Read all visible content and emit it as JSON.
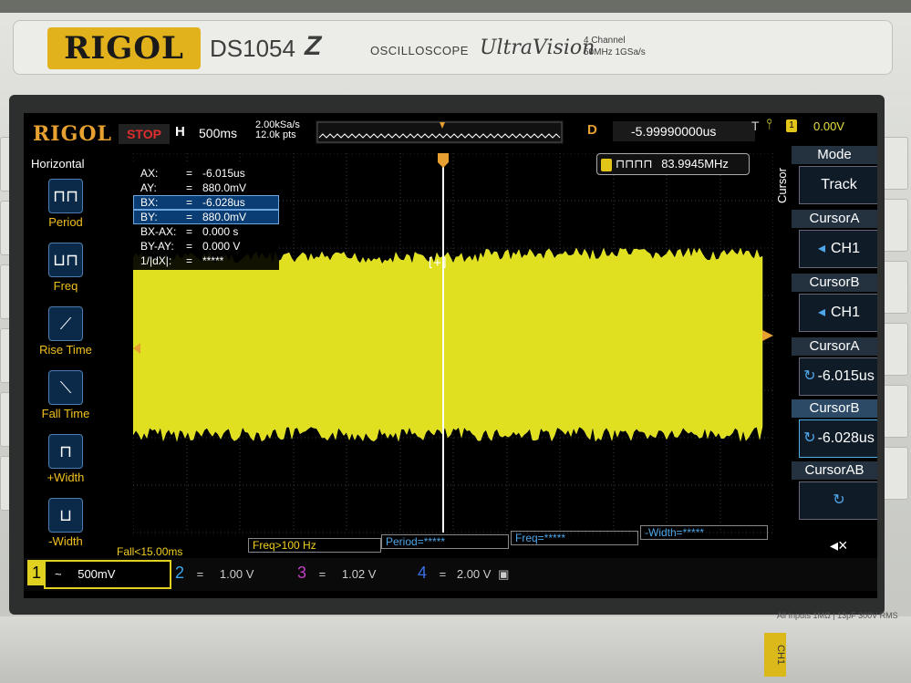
{
  "device": {
    "brand": "RIGOL",
    "model": "DS1054",
    "model_suffix": "Z",
    "type": "OSCILLOSCOPE",
    "series": "UltraVision",
    "spec_line1": "4 Channel",
    "spec_line2": "50MHz 1GSa/s",
    "inputs_label": "All Inputs 1MΩ | 13pF 300V RMS",
    "ch1_connector": "CH1"
  },
  "status": {
    "logo": "RIGOL",
    "run_state": "STOP",
    "timebase_prefix": "H",
    "timebase": "500ms",
    "sample_rate": "2.00kSa/s",
    "mem_points": "12.0k pts",
    "delay_prefix": "D",
    "delay": "-5.99990000us",
    "trigger_type": "T",
    "trigger_badge": "1",
    "trigger_level": "0.00V"
  },
  "left_menu": {
    "title": "Horizontal",
    "items": [
      {
        "label": "Period",
        "icon": "period-icon",
        "glyph": "⊓⊓"
      },
      {
        "label": "Freq",
        "icon": "freq-icon",
        "glyph": "⊔⊓"
      },
      {
        "label": "Rise Time",
        "icon": "rise-time-icon",
        "glyph": "⟋"
      },
      {
        "label": "Fall Time",
        "icon": "fall-time-icon",
        "glyph": "⟍"
      },
      {
        "label": "+Width",
        "icon": "plus-width-icon",
        "glyph": "⊓"
      },
      {
        "label": "-Width",
        "icon": "minus-width-icon",
        "glyph": "⊔"
      }
    ]
  },
  "cursor_readout": [
    {
      "key": "AX:",
      "value": "-6.015us",
      "highlight": false
    },
    {
      "key": "AY:",
      "value": "880.0mV",
      "highlight": false
    },
    {
      "key": "BX:",
      "value": "-6.028us",
      "highlight": true
    },
    {
      "key": "BY:",
      "value": "880.0mV",
      "highlight": true
    },
    {
      "key": "BX-AX:",
      "value": "0.000 s",
      "highlight": false
    },
    {
      "key": "BY-AY:",
      "value": "0.000 V",
      "highlight": false
    },
    {
      "key": "1/|dX|:",
      "value": "*****",
      "highlight": false
    }
  ],
  "freq_counter": "83.9945MHz",
  "right_menu": {
    "vertical_label": "Cursor",
    "mode_title": "Mode",
    "mode_value": "Track",
    "cursorA_title": "CursorA",
    "cursorA_source": "CH1",
    "cursorB_title": "CursorB",
    "cursorB_source": "CH1",
    "cursorA_pos_title": "CursorA",
    "cursorA_pos": "-6.015us",
    "cursorB_pos_title": "CursorB",
    "cursorB_pos": "-6.028us",
    "cursorAB_title": "CursorAB"
  },
  "measurements": {
    "fall": "Fall<15.00ms",
    "freq1": "Freq>100 Hz",
    "period": "Period=*****",
    "freq2": "Freq=*****",
    "width": "-Width=*****"
  },
  "channels": [
    {
      "num": "1",
      "coupling": "~",
      "scale": "500mV",
      "color": "#e0d020"
    },
    {
      "num": "2",
      "coupling": "=",
      "scale": "1.00 V",
      "color": "#3aa6e8"
    },
    {
      "num": "3",
      "coupling": "=",
      "scale": "1.02 V",
      "color": "#c040c0"
    },
    {
      "num": "4",
      "coupling": "=",
      "scale": "2.00 V",
      "color": "#3a6ee8"
    }
  ],
  "colors": {
    "ch1": "#e0d020",
    "accent_orange": "#e8a030",
    "stop_red": "#e02d2d",
    "cursor_blue": "#4fa6e8"
  }
}
